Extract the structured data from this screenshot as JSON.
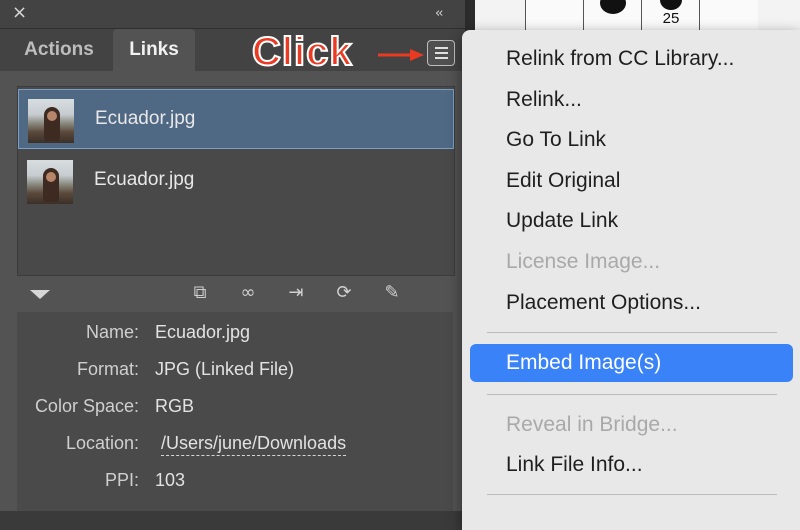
{
  "panel": {
    "close_icon": "×",
    "collapse_icon": "‹‹",
    "tabs": [
      {
        "label": "Actions",
        "active": false
      },
      {
        "label": "Links",
        "active": true
      }
    ],
    "menu_icon": "hamburger-menu-icon"
  },
  "annotation": {
    "label": "Click",
    "color": "#ea3a22"
  },
  "links": [
    {
      "name": "Ecuador.jpg",
      "selected": true
    },
    {
      "name": "Ecuador.jpg",
      "selected": false
    }
  ],
  "toolbar": {
    "icons": [
      "relink-from-library-icon",
      "relink-icon",
      "go-to-link-icon",
      "update-link-icon",
      "edit-original-icon"
    ]
  },
  "info": {
    "rows": [
      {
        "label": "Name:",
        "value": "Ecuador.jpg"
      },
      {
        "label": "Format:",
        "value": "JPG (Linked File)"
      },
      {
        "label": "Color Space:",
        "value": "RGB"
      },
      {
        "label": "Location:",
        "value": "/Users/june/Downloads"
      },
      {
        "label": "PPI:",
        "value": "103"
      }
    ]
  },
  "background": {
    "number": "25"
  },
  "menu": {
    "items": [
      {
        "label": "Relink from CC Library...",
        "enabled": true
      },
      {
        "label": "Relink...",
        "enabled": true
      },
      {
        "label": "Go To Link",
        "enabled": true
      },
      {
        "label": "Edit Original",
        "enabled": true
      },
      {
        "label": "Update Link",
        "enabled": true
      },
      {
        "label": "License Image...",
        "enabled": false
      },
      {
        "label": "Placement Options...",
        "enabled": true
      },
      {
        "label": "Embed Image(s)",
        "enabled": true,
        "highlighted": true
      },
      {
        "label": "Reveal in Bridge...",
        "enabled": false
      },
      {
        "label": "Link File Info...",
        "enabled": true
      }
    ],
    "highlight_color": "#3a82f7"
  }
}
